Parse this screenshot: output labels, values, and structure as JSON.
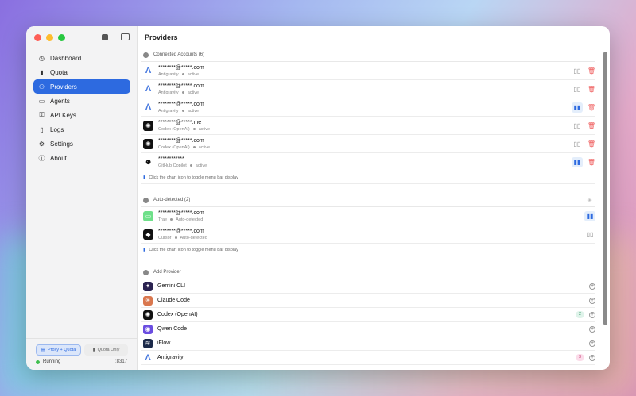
{
  "window": {
    "title": "Providers"
  },
  "sidebar": {
    "items": [
      {
        "label": "Dashboard",
        "icon": "clock-icon"
      },
      {
        "label": "Quota",
        "icon": "bar-chart-icon"
      },
      {
        "label": "Providers",
        "icon": "people-icon",
        "active": true
      },
      {
        "label": "Agents",
        "icon": "terminal-icon"
      },
      {
        "label": "API Keys",
        "icon": "key-icon"
      },
      {
        "label": "Logs",
        "icon": "document-icon"
      },
      {
        "label": "Settings",
        "icon": "gear-icon"
      },
      {
        "label": "About",
        "icon": "info-icon"
      }
    ],
    "modes": {
      "proxy": "Proxy + Quota",
      "quota": "Quota Only"
    },
    "status": "Running",
    "port": ":8317"
  },
  "connected": {
    "header": "Connected Accounts (6)",
    "accounts": [
      {
        "email": "********@*****.com",
        "provider": "Antigravity",
        "status": "active",
        "chart_on": false
      },
      {
        "email": "********@*****.com",
        "provider": "Antigravity",
        "status": "active",
        "chart_on": false
      },
      {
        "email": "********@*****.com",
        "provider": "Antigravity",
        "status": "active",
        "chart_on": true
      },
      {
        "email": "********@*****.me",
        "provider": "Codex (OpenAI)",
        "status": "active",
        "chart_on": false
      },
      {
        "email": "********@*****.com",
        "provider": "Codex (OpenAI)",
        "status": "active",
        "chart_on": false
      },
      {
        "email": "************",
        "provider": "GitHub Copilot",
        "status": "active",
        "chart_on": true
      }
    ],
    "hint": "Click the chart icon to toggle menu bar display"
  },
  "detected": {
    "header": "Auto-detected (2)",
    "accounts": [
      {
        "email": "********@*****.com",
        "provider": "Trae",
        "status": "Auto-detected",
        "chart_on": true
      },
      {
        "email": "********@*****.com",
        "provider": "Cursor",
        "status": "Auto-detected",
        "chart_on": false
      }
    ],
    "hint": "Click the chart icon to toggle menu bar display"
  },
  "add": {
    "header": "Add Provider",
    "providers": [
      {
        "name": "Gemini CLI",
        "badge": null
      },
      {
        "name": "Claude Code",
        "badge": null
      },
      {
        "name": "Codex (OpenAI)",
        "badge": "2"
      },
      {
        "name": "Qwen Code",
        "badge": null
      },
      {
        "name": "iFlow",
        "badge": null
      },
      {
        "name": "Antigravity",
        "badge": "3"
      }
    ]
  },
  "colors": {
    "accent": "#2d6ae0",
    "delete": "#e55555"
  }
}
